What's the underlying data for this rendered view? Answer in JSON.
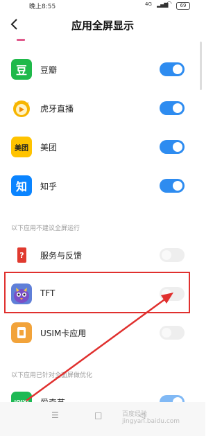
{
  "status_bar": {
    "time": "晚上8:55",
    "network": "4G",
    "battery": "69"
  },
  "header": {
    "title": "应用全屏显示"
  },
  "apps_supported": [
    {
      "name": "豆瓣",
      "icon_text": "豆",
      "icon_color": "#1fb94a",
      "enabled": true
    },
    {
      "name": "虎牙直播",
      "icon_text": "",
      "icon_color": "#f4b400",
      "enabled": true
    },
    {
      "name": "美团",
      "icon_text": "美团",
      "icon_color": "#ffc300",
      "enabled": true
    },
    {
      "name": "知乎",
      "icon_text": "知",
      "icon_color": "#0a84ff",
      "enabled": true
    }
  ],
  "section_not_recommended": "以下应用不建议全屏运行",
  "apps_not_recommended": [
    {
      "name": "服务与反馈",
      "icon_text": "?",
      "icon_color": "#e03a2f",
      "enabled": false
    },
    {
      "name": "TFT",
      "icon_text": "",
      "icon_color": "#6d5bd0",
      "enabled": false
    },
    {
      "name": "USIM卡应用",
      "icon_text": "",
      "icon_color": "#f2a33a",
      "enabled": false
    }
  ],
  "section_optimized": "以下应用已针对全面屏做优化",
  "apps_optimized": [
    {
      "name": "爱奇艺",
      "icon_text": "iQIYI",
      "icon_color": "#1db954",
      "enabled": true
    }
  ],
  "watermark": "百度经验 jingyan.baidu.com",
  "nav_buttons": {
    "menu": "☰",
    "home": "□",
    "back": "◁"
  },
  "colors": {
    "accent": "#2e8cf0",
    "highlight": "#e0302e"
  }
}
